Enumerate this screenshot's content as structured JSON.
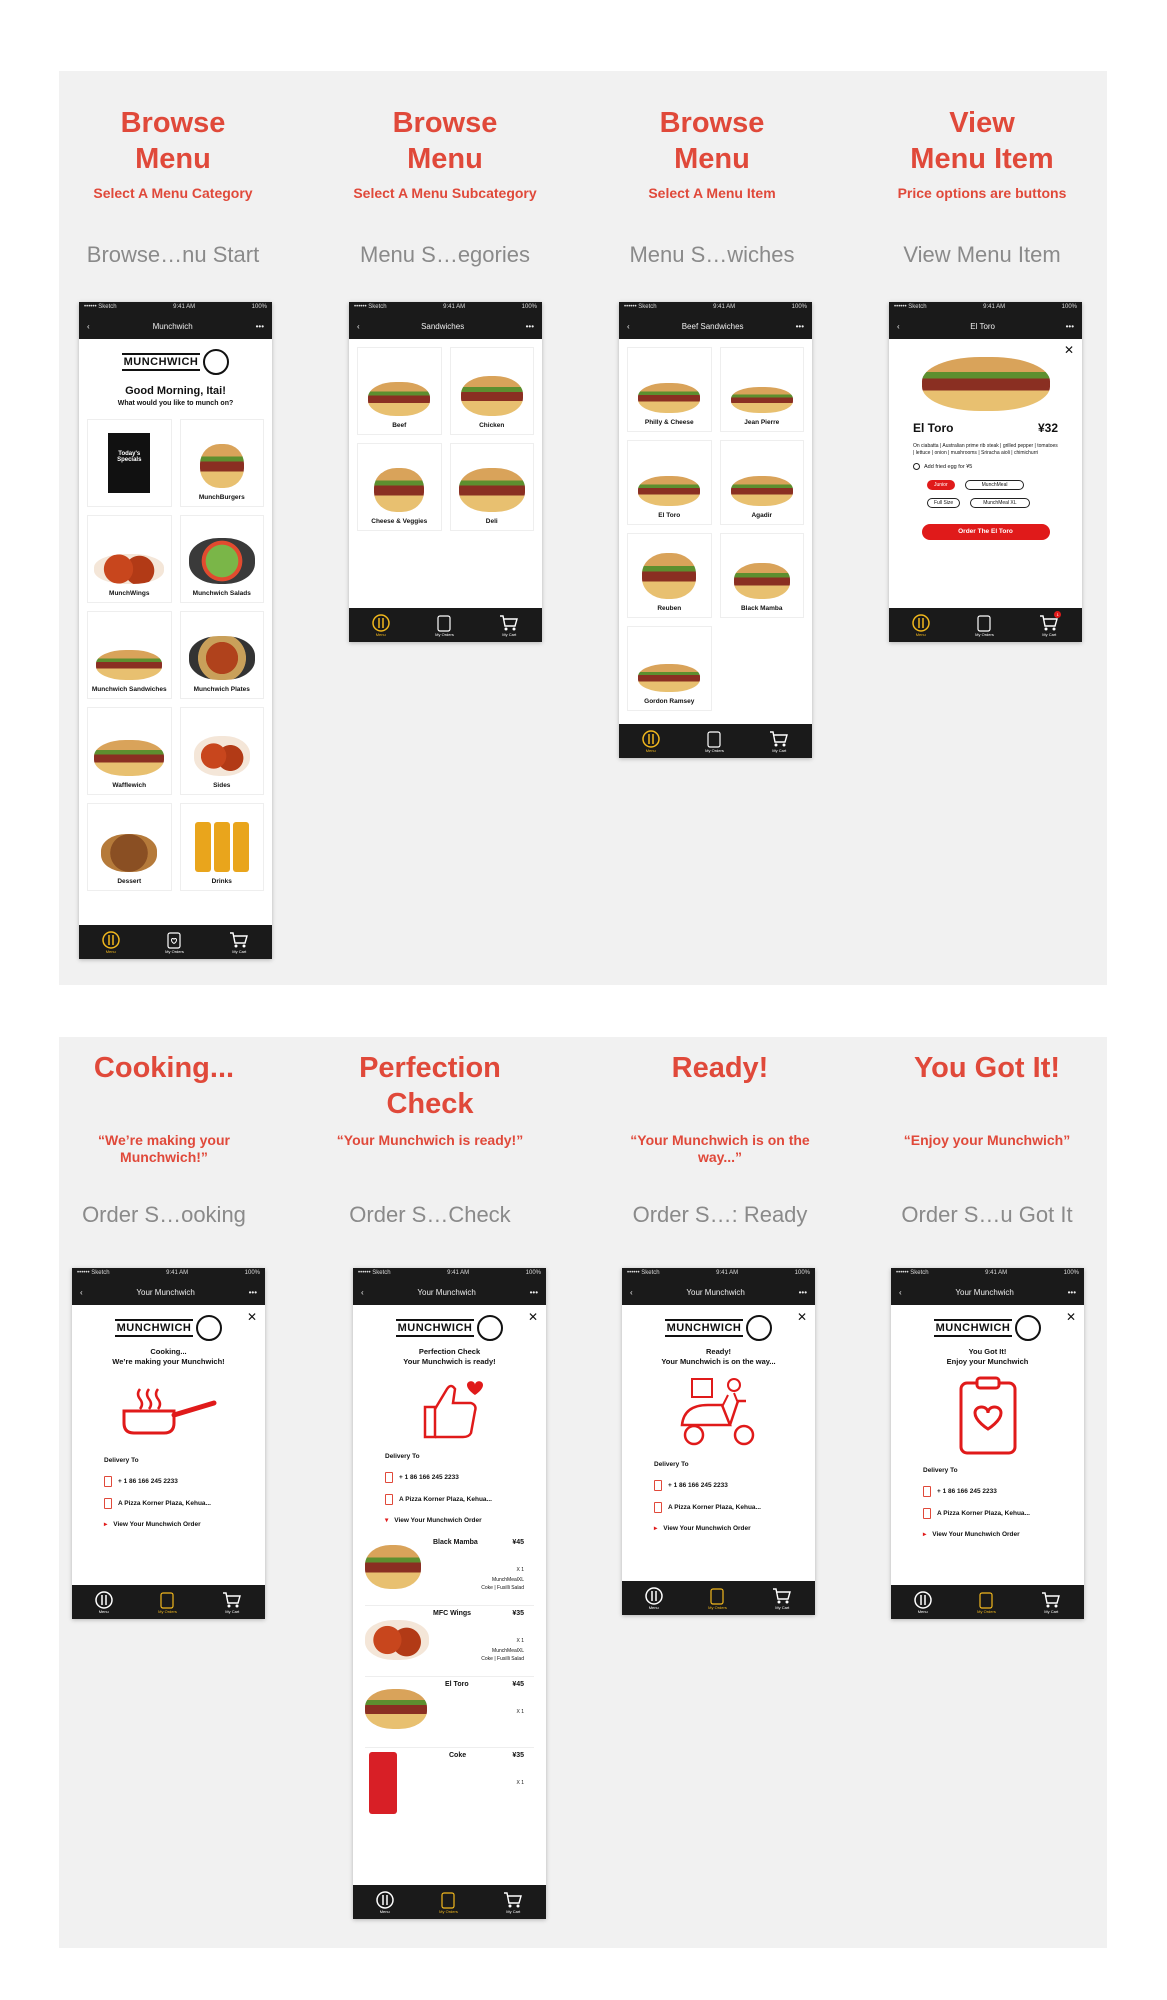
{
  "top_row": [
    {
      "heading": "Browse\nMenu",
      "sub": "Select A Menu Category",
      "artboard": "Browse…nu Start"
    },
    {
      "heading": "Browse\nMenu",
      "sub": "Select A Menu Subcategory",
      "artboard": "Menu S…egories"
    },
    {
      "heading": "Browse\nMenu",
      "sub": "Select A Menu Item",
      "artboard": "Menu S…wiches"
    },
    {
      "heading": "View\nMenu Item",
      "sub": "Price options are buttons",
      "artboard": "View Menu Item"
    }
  ],
  "bottom_row": [
    {
      "heading": "Cooking...",
      "sub": "“We’re making your\nMunchwich!”",
      "artboard": "Order S…ooking"
    },
    {
      "heading": "Perfection\nCheck",
      "sub": "“Your Munchwich is ready!”",
      "artboard": "Order S…Check"
    },
    {
      "heading": "Ready!",
      "sub": "“Your Munchwich is on the\nway...”",
      "artboard": "Order S…: Ready"
    },
    {
      "heading": "You Got It!",
      "sub": "“Enjoy your Munchwich”",
      "artboard": "Order S…u Got It"
    }
  ],
  "status": {
    "carrier": "•••••• Sketch",
    "time": "9:41 AM",
    "battery": "100%"
  },
  "tabs": {
    "menu": "Menu",
    "orders": "My Orders",
    "cart": "My Cart"
  },
  "logo": "MUNCHWICH",
  "screen1": {
    "title": "Munchwich",
    "greeting": "Good Morning, Itai!",
    "question": "What would you like to munch on?",
    "specials": "Today's Specials",
    "tiles": [
      "",
      "MunchBurgers",
      "MunchWings",
      "Munchwich Salads",
      "Munchwich Sandwiches",
      "Munchwich Plates",
      "Wafflewich",
      "Sides",
      "Dessert",
      "Drinks"
    ]
  },
  "screen2": {
    "title": "Sandwiches",
    "tiles": [
      "Beef",
      "Chicken",
      "Cheese & Veggies",
      "Deli"
    ]
  },
  "screen3": {
    "title": "Beef Sandwiches",
    "tiles": [
      "Philly & Cheese",
      "Jean Pierre",
      "El Toro",
      "Agadir",
      "Reuben",
      "Black Mamba",
      "Gordon Ramsey"
    ]
  },
  "screen4": {
    "title": "El Toro",
    "name": "El Toro",
    "price": "¥32",
    "desc": "On ciabatta | Australian prime rib steak | grilled pepper | tomatoes | lettuce | onion | mushrooms | Sriracha aioli | chimichurri",
    "addon": "Add fried egg for ¥5",
    "opts": [
      "Junior",
      "MunchMeal",
      "Full Size",
      "MunchMeal XL"
    ],
    "order": "Order The El Toro",
    "cart_badge": "1"
  },
  "order_title": "Your Munchwich",
  "status_screens": [
    {
      "l1": "Cooking...",
      "l2": "We’re making your Munchwich!",
      "icon": "pan-icon"
    },
    {
      "l1": "Perfection Check",
      "l2": "Your Munchwich is ready!",
      "icon": "thumbs-up-icon"
    },
    {
      "l1": "Ready!",
      "l2": "Your Munchwich is on the way...",
      "icon": "scooter-icon"
    },
    {
      "l1": "You Got It!",
      "l2": "Enjoy your Munchwich",
      "icon": "clipboard-heart-icon"
    }
  ],
  "delivery": {
    "label": "Delivery To",
    "phone": "+ 1 86 166 245 2233",
    "address": "A Pizza Korner Plaza, Kehua...",
    "view": "View Your Munchwich Order"
  },
  "order_items": [
    {
      "name": "Black Mamba",
      "price": "¥45",
      "qty": "X 1",
      "l1": "MunchMealXL",
      "l2": "Coke | Fusilli Salad"
    },
    {
      "name": "MFC Wings",
      "price": "¥35",
      "qty": "X 1",
      "l1": "MunchMealXL",
      "l2": "Coke | Fusilli Salad"
    },
    {
      "name": "El Toro",
      "price": "¥45",
      "qty": "X 1",
      "l1": "",
      "l2": ""
    },
    {
      "name": "Coke",
      "price": "¥35",
      "qty": "X 1",
      "l1": "",
      "l2": ""
    }
  ],
  "colors": {
    "accent": "#e0493a",
    "tab_active": "#f2b81d",
    "dark": "#1a1a1a"
  }
}
